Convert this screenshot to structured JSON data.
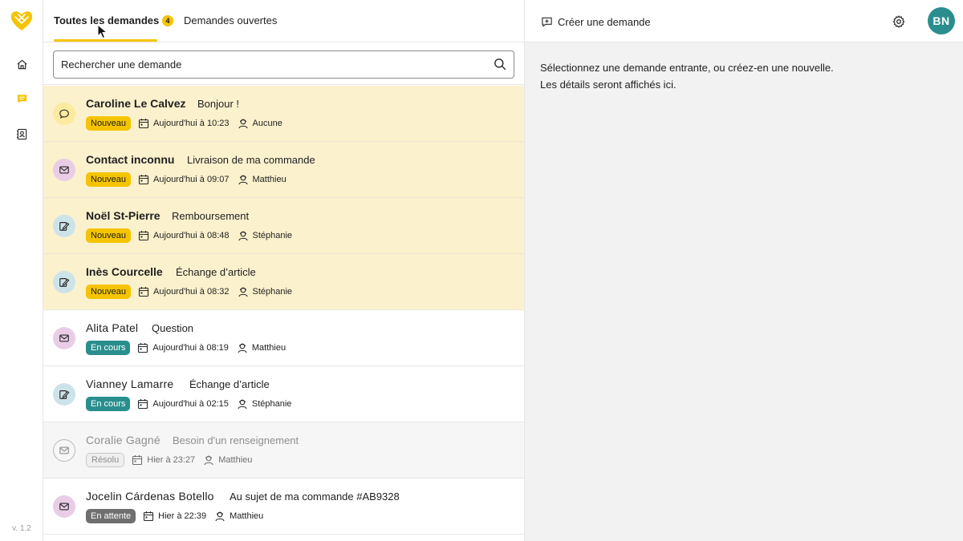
{
  "app": {
    "version": "v. 1.2",
    "user_initials": "BN"
  },
  "tabs": {
    "all_label": "Toutes les demandes",
    "all_count": "4",
    "open_label": "Demandes ouvertes"
  },
  "search": {
    "placeholder": "Rechercher une demande"
  },
  "right": {
    "create_label": "Créer une demande",
    "empty_line1": "Sélectionnez une demande entrante, ou créez-en une nouvelle.",
    "empty_line2": "Les détails seront affichés ici."
  },
  "colors": {
    "accent": "#f5c400",
    "teal": "#2a8e8e",
    "new_row_bg": "#fbf1cd"
  },
  "requests": [
    {
      "name": "Caroline Le Calvez",
      "subject": "Bonjour !",
      "status": "Nouveau",
      "date": "Aujourd'hui à 10:23",
      "assignee": "Aucune",
      "channel": "chat-icon"
    },
    {
      "name": "Contact inconnu",
      "subject": "Livraison de ma commande",
      "status": "Nouveau",
      "date": "Aujourd'hui à 09:07",
      "assignee": "Matthieu",
      "channel": "mail-icon"
    },
    {
      "name": "Noël St-Pierre",
      "subject": "Remboursement",
      "status": "Nouveau",
      "date": "Aujourd'hui à 08:48",
      "assignee": "Stéphanie",
      "channel": "form-icon"
    },
    {
      "name": "Inès Courcelle",
      "subject": "Échange d’article",
      "status": "Nouveau",
      "date": "Aujourd'hui à 08:32",
      "assignee": "Stéphanie",
      "channel": "form-icon"
    },
    {
      "name": "Alita Patel",
      "subject": "Question",
      "status": "En cours",
      "date": "Aujourd'hui à 08:19",
      "assignee": "Matthieu",
      "channel": "mail-icon"
    },
    {
      "name": "Vianney Lamarre",
      "subject": "Échange d’article",
      "status": "En cours",
      "date": "Aujourd'hui à 02:15",
      "assignee": "Stéphanie",
      "channel": "form-icon"
    },
    {
      "name": "Coralie Gagné",
      "subject": "Besoin d'un renseignement",
      "status": "Résolu",
      "date": "Hier à 23:27",
      "assignee": "Matthieu",
      "channel": "mail-icon"
    },
    {
      "name": "Jocelin Cárdenas Botello",
      "subject": "Au sujet de ma commande #AB9328",
      "status": "En attente",
      "date": "Hier à 22:39",
      "assignee": "Matthieu",
      "channel": "mail-icon"
    }
  ]
}
